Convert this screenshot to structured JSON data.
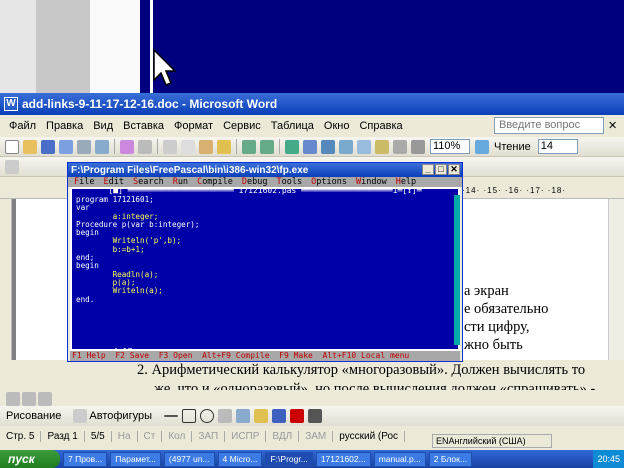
{
  "word": {
    "title": "add-links-9-11-17-12-16.doc - Microsoft Word",
    "menu": [
      "Файл",
      "Правка",
      "Вид",
      "Вставка",
      "Формат",
      "Сервис",
      "Таблица",
      "Окно",
      "Справка"
    ],
    "search_placeholder": "Введите вопрос",
    "zoom": "110%",
    "read_label": "Чтение",
    "font_size": "14",
    "ruler_ticks": "·14·  ·15·  ·16·  ·17·  ·18·",
    "doc_lines": [
      "а экран",
      "е обязательно",
      "сти цифру,",
      "жно быть",
      "2.   Арифметический калькулятор «многоразовый». Должен вычислять то",
      "же, что и «одноразовый», но после вычисления должен «спрашивать» -"
    ],
    "draw_label": "Рисование",
    "autoshapes_label": "Автофигуры",
    "status": {
      "page": "Стр. 5",
      "section": "Разд 1",
      "pages": "5/5",
      "at": "На",
      "line": "Ст",
      "col": "Кол",
      "rec": "ЗАП",
      "trk": "ИСПР",
      "ext": "ВДЛ",
      "ovr": "ЗАМ",
      "lang": "русский (Рос"
    },
    "lang_bar": "ENАнглийский (США)"
  },
  "fp": {
    "title": "F:\\Program Files\\FreePascal\\bin\\i386-win32\\fp.exe",
    "menu": [
      "File",
      "Edit",
      "Search",
      "Run",
      "Compile",
      "Debug",
      "Tools",
      "Options",
      "Window",
      "Help"
    ],
    "editor_title": "[■] ══════════════════════ 17121602.pas ═══════════════════1═[↕]═",
    "code": [
      "program 17121601;",
      "var",
      "        a:integer;",
      "Procedure p(var b:integer);",
      "begin",
      "        Writeln('p',b);",
      "        b:=b+1;",
      "end;",
      "begin",
      "        Readln(a);",
      "        p(a);",
      "        Writeln(a);",
      "end."
    ],
    "cursor_pos": "4:17",
    "status_items": [
      "F1 Help",
      "F2 Save",
      "F3 Open",
      "Alt+F9 Compile",
      "F9 Make",
      "Alt+F10 Local menu"
    ]
  },
  "taskbar": {
    "start": "пуск",
    "tasks": [
      "7 Пров...",
      "Парамет...",
      "(4977 un...",
      "4 Micro...",
      "F:\\Progr...",
      "17121602...",
      "manual.p...",
      "2 Блок..."
    ],
    "active_index": 4,
    "clock": "20:45"
  }
}
